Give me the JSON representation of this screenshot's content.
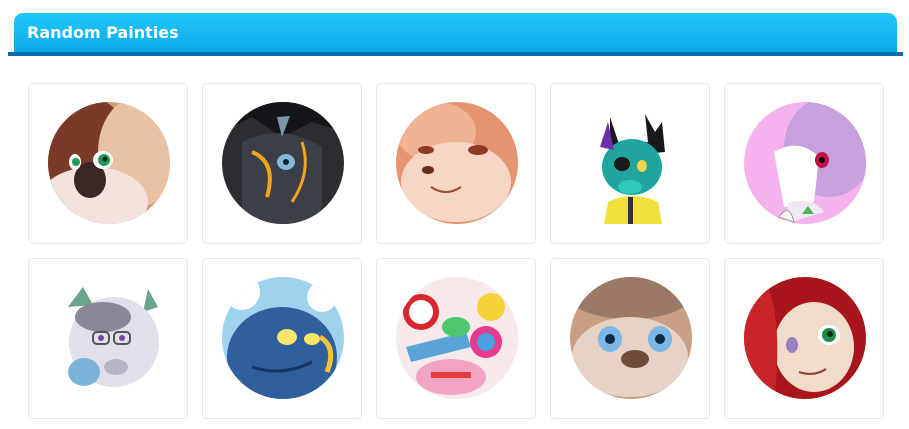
{
  "header": {
    "title": "Random Painties"
  },
  "gallery": {
    "items": [
      {
        "icon": "calico-cat-avatar-icon"
      },
      {
        "icon": "black-dragon-avatar-icon"
      },
      {
        "icon": "peach-fox-avatar-icon"
      },
      {
        "icon": "teal-cat-avatar-icon"
      },
      {
        "icon": "lavender-pony-avatar-icon"
      },
      {
        "icon": "grey-wolf-avatar-icon"
      },
      {
        "icon": "blue-dragon-avatar-icon"
      },
      {
        "icon": "candy-creature-avatar-icon"
      },
      {
        "icon": "siamese-cat-avatar-icon"
      },
      {
        "icon": "red-haired-cat-avatar-icon"
      }
    ]
  }
}
